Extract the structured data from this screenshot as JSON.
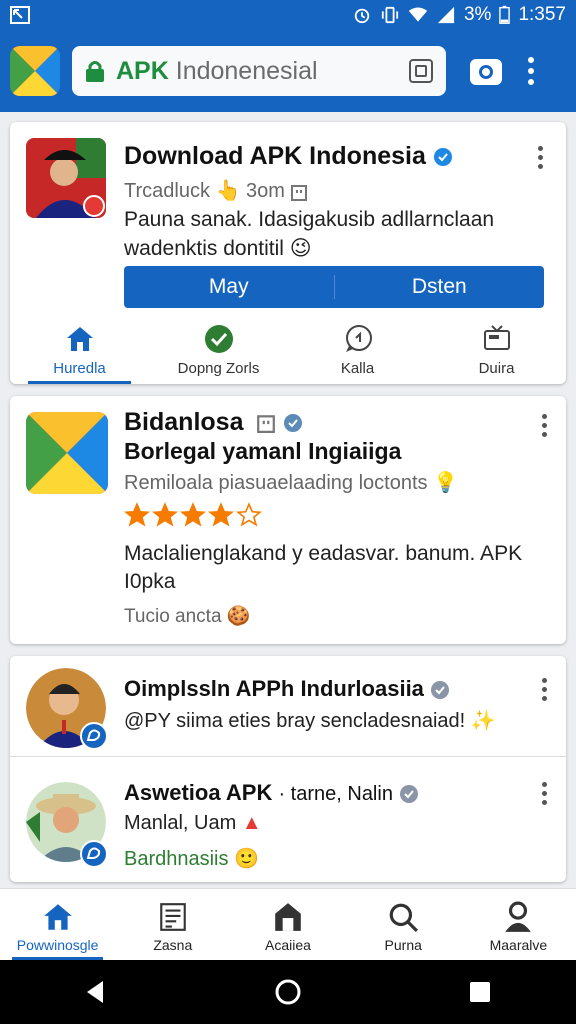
{
  "status": {
    "battery": "3%",
    "time": "1:357"
  },
  "urlbar": {
    "prefix": "APK",
    "text": "Indonenesial"
  },
  "card1": {
    "title": "Download APK Indonesia",
    "meta": "Trcadluck",
    "meta_time": "3om",
    "desc1": "Pauna sanak. Idasigakusib adllarnclaan",
    "desc2": "wadenktis dontitil",
    "btn_left": "May",
    "btn_right": "Dsten",
    "tabs": [
      {
        "label": "Huredla"
      },
      {
        "label": "Dopng Zorls"
      },
      {
        "label": "Kalla"
      },
      {
        "label": "Duira"
      }
    ]
  },
  "card2": {
    "title": "Bidanlosa",
    "subtitle": "Borlegal yamanl Ingiaiiga",
    "line": "Remiloala piasuaelaading loctonts",
    "rating": 4,
    "rating_max": 5,
    "desc1": "Maclalienglakand y eadasvar. banum. APK",
    "desc2": "I0pka",
    "footer": "Tucio ancta"
  },
  "card3": {
    "post1": {
      "title": "Oimplssln APPh Indurloasiia",
      "text": "@PY siima eties bray sencladesnaiad!"
    },
    "post2": {
      "title": "Aswetioa APK",
      "title_extra": "· tarne, Nalin",
      "text": "Manlal, Uam",
      "status": "Bardhnasiis"
    }
  },
  "bottomnav": [
    {
      "label": "Powwinosgle"
    },
    {
      "label": "Zasna"
    },
    {
      "label": "Acaiiea"
    },
    {
      "label": "Purna"
    },
    {
      "label": "Maaralve"
    }
  ],
  "colors": {
    "primary": "#1565c0",
    "green": "#1e8e3e",
    "star": "#f57c00"
  }
}
